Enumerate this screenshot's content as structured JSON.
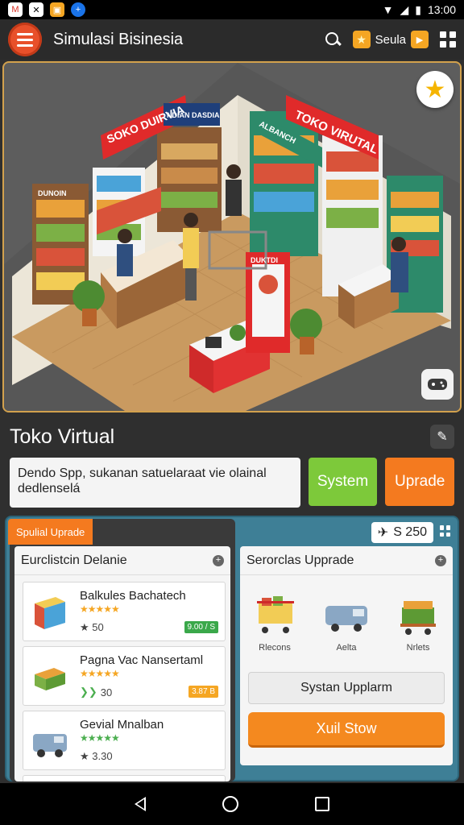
{
  "status_bar": {
    "time": "13:00"
  },
  "app": {
    "title": "Simulasi Bisinesia",
    "star_label": "Seula"
  },
  "store": {
    "name": "Toko Virtual",
    "description": "Dendo Spp, sukanan satuelaraat vie olainal dedlenselá",
    "system_button": "System",
    "upgrade_button": "Uprade",
    "sign_left": "SOKO DUIRVIA",
    "sign_right": "TOKO VIRUTAL",
    "sign_small": "ALBANCH",
    "sign_small2": "NDIAN DASDIA",
    "sign_shelf": "DUNOIN",
    "machine_label": "DUKTDI"
  },
  "panel": {
    "tag": "Spulial Uprade",
    "coins": "S 250",
    "list_title": "Eurclistcin Delanie",
    "items": [
      {
        "name": "Balkules Bachatech",
        "stars": "★★★★★",
        "meta": "★ 50",
        "price": "9.00 / S",
        "price_color": "#3aa84a"
      },
      {
        "name": "Pagna Vac Nansertaml",
        "stars": "★★★★★",
        "meta": "30",
        "price": "3.87 B",
        "price_color": "#f5a623"
      },
      {
        "name": "Gevial Mnalban",
        "stars": "★★★★★",
        "meta": "★ 3.30",
        "price": "",
        "price_color": ""
      }
    ],
    "upgrade_title": "Serorclas Upprade",
    "vehicles": [
      {
        "label": "Rlecons"
      },
      {
        "label": "Aelta"
      },
      {
        "label": "Nrlets"
      }
    ],
    "system_upgrade": "Systan Upplarm",
    "start_button": "Xuil Stow"
  },
  "colors": {
    "accent": "#f47a1f",
    "green": "#7dc93a",
    "panel": "#3e7f96",
    "menu": "#e8502a"
  }
}
